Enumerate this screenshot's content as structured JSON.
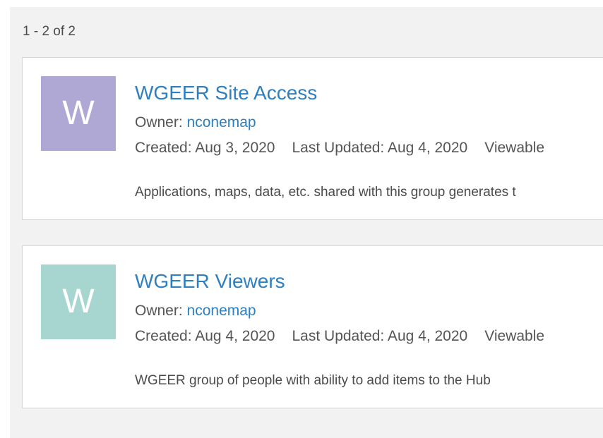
{
  "results": {
    "count_text": "1 - 2 of 2"
  },
  "groups": [
    {
      "thumbnail_letter": "W",
      "thumbnail_color": "#b0a8d4",
      "title": "WGEER Site Access",
      "owner_label": "Owner: ",
      "owner": "nconemap",
      "created": "Created: Aug 3, 2020",
      "last_updated": "Last Updated: Aug 4, 2020",
      "access": "Viewable",
      "description": "Applications, maps, data, etc. shared with this group generates t"
    },
    {
      "thumbnail_letter": "W",
      "thumbnail_color": "#a7d6d0",
      "title": "WGEER Viewers",
      "owner_label": "Owner: ",
      "owner": "nconemap",
      "created": "Created: Aug 4, 2020",
      "last_updated": "Last Updated: Aug 4, 2020",
      "access": "Viewable",
      "description": "WGEER group of people with ability to add items to the Hub"
    }
  ],
  "colors": {
    "link": "#2d7fc0",
    "panel_background": "#f2f2f2",
    "card_border": "#d6d6d6"
  }
}
